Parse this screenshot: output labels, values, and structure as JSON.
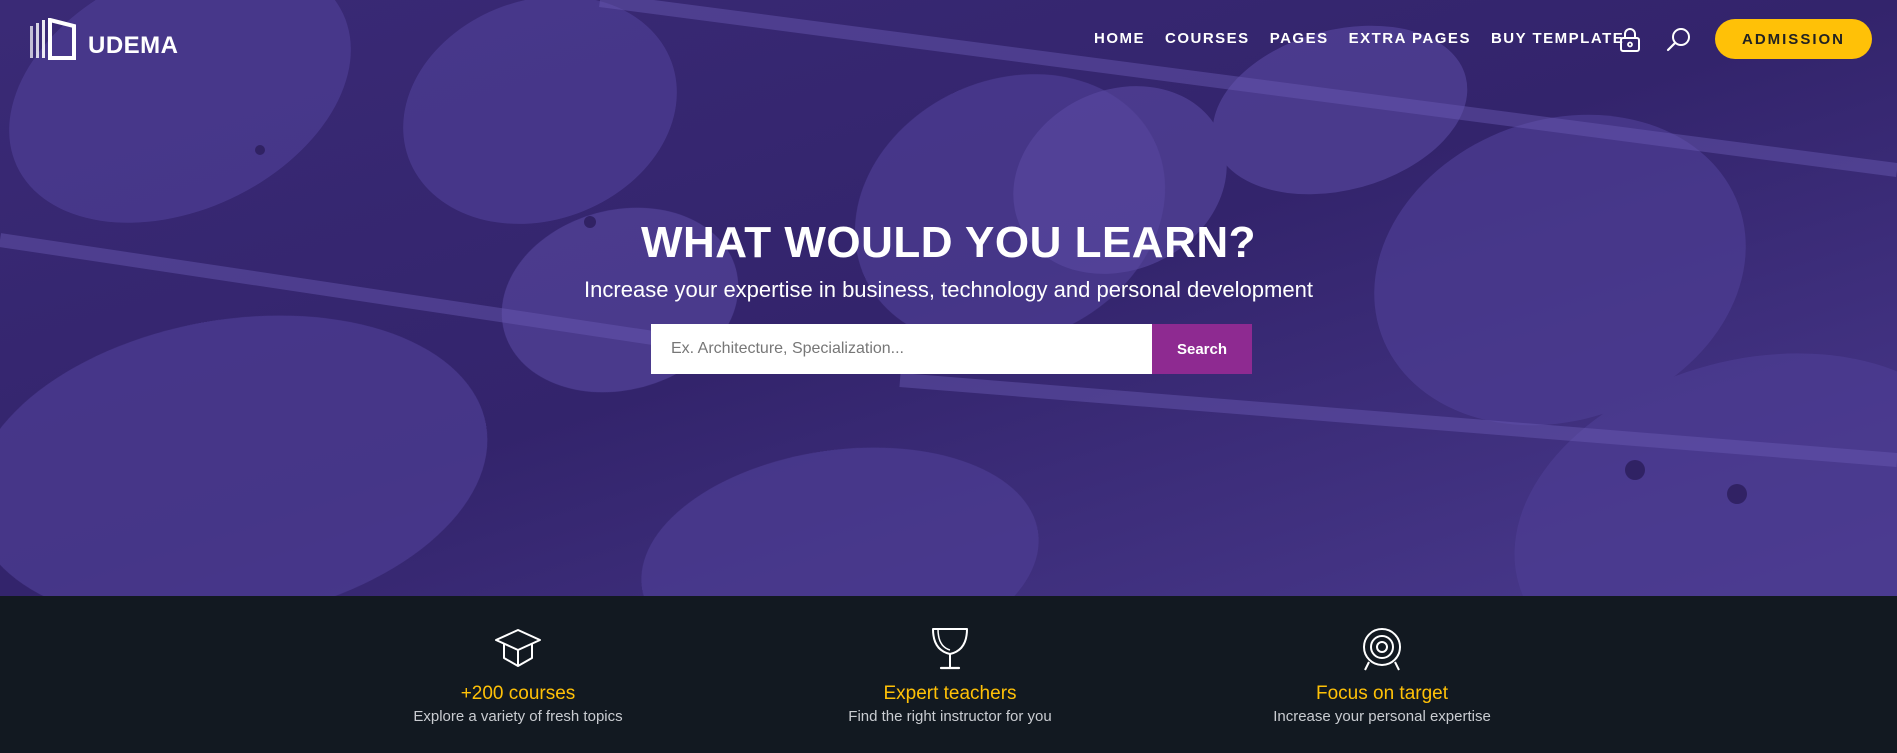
{
  "brand": {
    "name": "UDEMA"
  },
  "nav": {
    "items": [
      {
        "label": "HOME"
      },
      {
        "label": "COURSES"
      },
      {
        "label": "PAGES"
      },
      {
        "label": "EXTRA PAGES"
      },
      {
        "label": "BUY TEMPLATE"
      }
    ],
    "icons": [
      "lock-icon",
      "search-icon"
    ],
    "cta_label": "ADMISSION"
  },
  "hero": {
    "title": "WHAT WOULD YOU LEARN?",
    "subtitle": "Increase your expertise in business, technology and personal development",
    "search": {
      "placeholder": "Ex. Architecture, Specialization...",
      "value": "",
      "button_label": "Search"
    }
  },
  "features": [
    {
      "icon": "graduation-cap-icon",
      "title": "+200 courses",
      "description": "Explore a variety of fresh topics"
    },
    {
      "icon": "trophy-icon",
      "title": "Expert teachers",
      "description": "Find the right instructor for you"
    },
    {
      "icon": "target-icon",
      "title": "Focus on target",
      "description": "Increase your personal expertise"
    }
  ],
  "colors": {
    "hero_overlay": "#3b2a78",
    "accent_yellow": "#ffc107",
    "search_button": "#8e2a91",
    "footer_bar": "#121921"
  }
}
